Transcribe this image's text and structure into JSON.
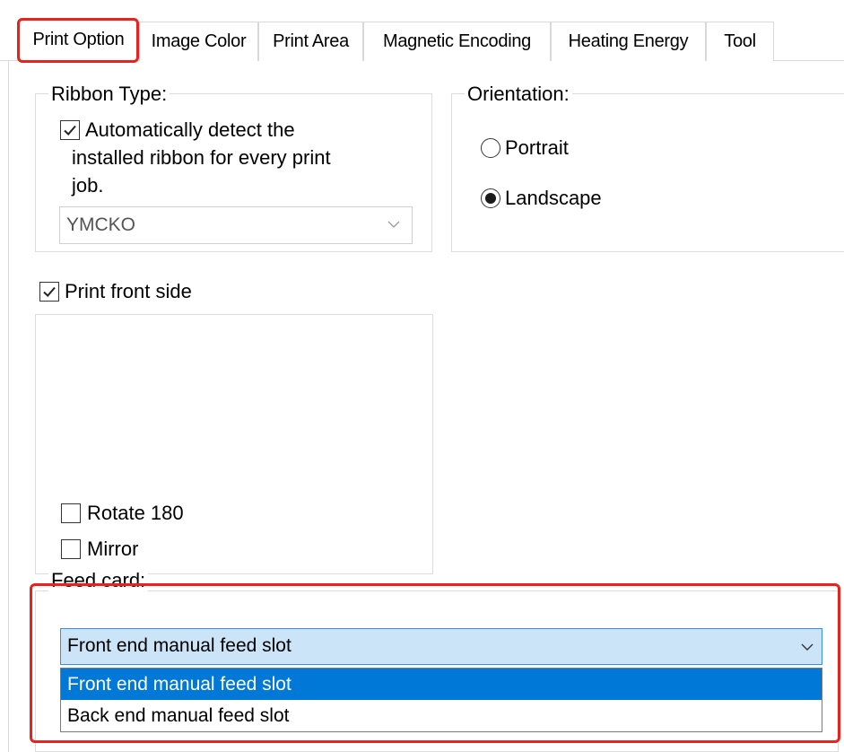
{
  "tabs": [
    {
      "label": "Print Option",
      "active": true
    },
    {
      "label": "Image Color",
      "active": false
    },
    {
      "label": "Print Area",
      "active": false
    },
    {
      "label": "Magnetic Encoding",
      "active": false
    },
    {
      "label": "Heating Energy",
      "active": false
    },
    {
      "label": "Tool",
      "active": false
    }
  ],
  "ribbon": {
    "legend": "Ribbon Type:",
    "auto_detect_line1": "Automatically detect the",
    "auto_detect_line2": "installed ribbon for every print",
    "auto_detect_line3": "job.",
    "auto_detect_checked": true,
    "selected": "YMCKO"
  },
  "orientation": {
    "legend": "Orientation:",
    "options": [
      "Portrait",
      "Landscape"
    ],
    "selected": "Landscape"
  },
  "print_front": {
    "label": "Print front side",
    "checked": true,
    "rotate_label": "Rotate 180",
    "rotate_checked": false,
    "mirror_label": "Mirror",
    "mirror_checked": false
  },
  "feed_card": {
    "legend": "Feed card:",
    "selected": "Front end manual feed slot",
    "options": [
      "Front end manual feed slot",
      "Back end manual feed slot"
    ]
  },
  "colors": {
    "highlight": "#e8231f",
    "selection": "#0078d7",
    "combo_focus_bg": "#cce4f7"
  }
}
